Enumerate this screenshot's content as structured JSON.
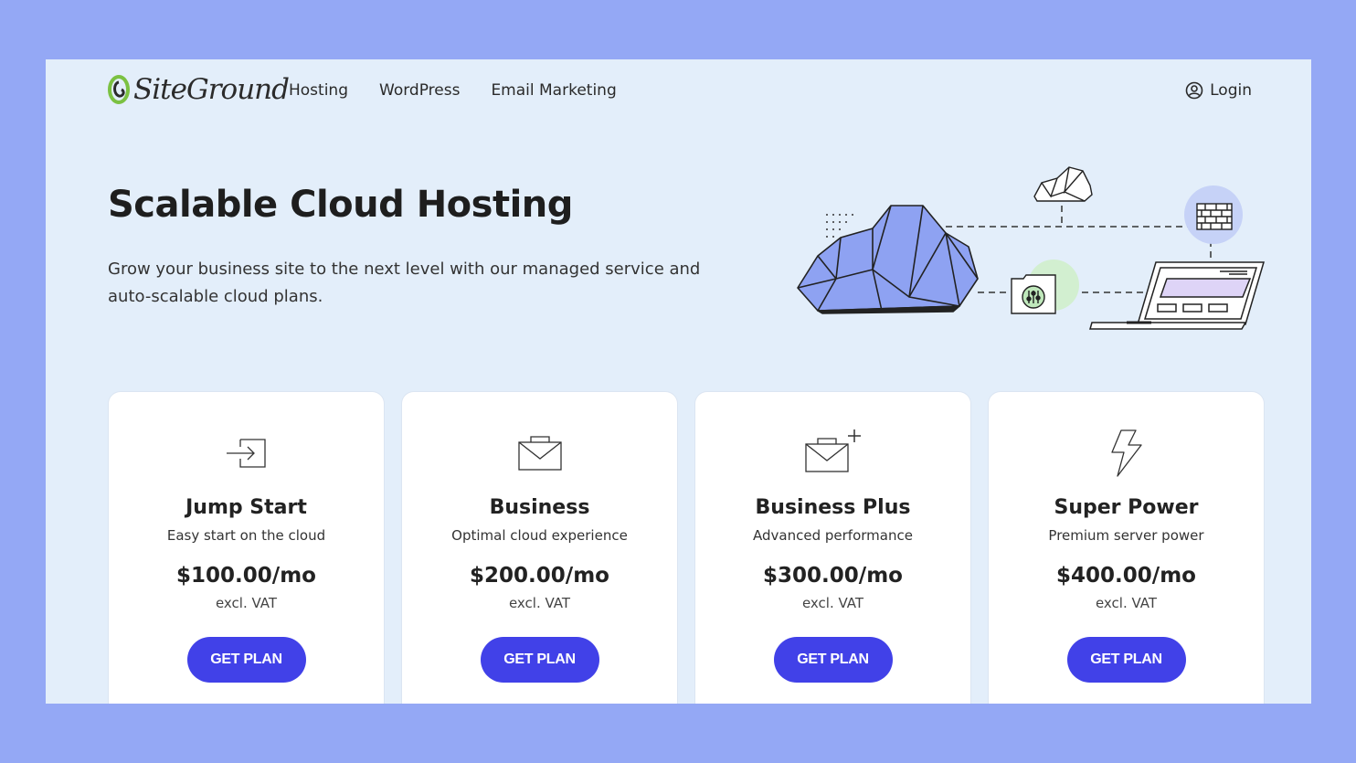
{
  "header": {
    "logo_text": "SiteGround",
    "nav": [
      "Hosting",
      "WordPress",
      "Email Marketing"
    ],
    "login_label": "Login"
  },
  "hero": {
    "title": "Scalable Cloud Hosting",
    "description": "Grow your business site to the next level with our managed service and auto-scalable cloud plans."
  },
  "plans": [
    {
      "name": "Jump Start",
      "tagline": "Easy start on the cloud",
      "price": "$100.00/mo",
      "vat": "excl. VAT",
      "button": "GET PLAN",
      "icon": "arrow-into-box-icon"
    },
    {
      "name": "Business",
      "tagline": "Optimal cloud experience",
      "price": "$200.00/mo",
      "vat": "excl. VAT",
      "button": "GET PLAN",
      "icon": "envelope-icon"
    },
    {
      "name": "Business Plus",
      "tagline": "Advanced performance",
      "price": "$300.00/mo",
      "vat": "excl. VAT",
      "button": "GET PLAN",
      "icon": "envelope-plus-icon"
    },
    {
      "name": "Super Power",
      "tagline": "Premium server power",
      "price": "$400.00/mo",
      "vat": "excl. VAT",
      "button": "GET PLAN",
      "icon": "lightning-bolt-icon"
    }
  ],
  "colors": {
    "background": "#94a8f5",
    "page": "#e3eefa",
    "accent": "#4141e8",
    "logo_green": "#7bc142"
  }
}
